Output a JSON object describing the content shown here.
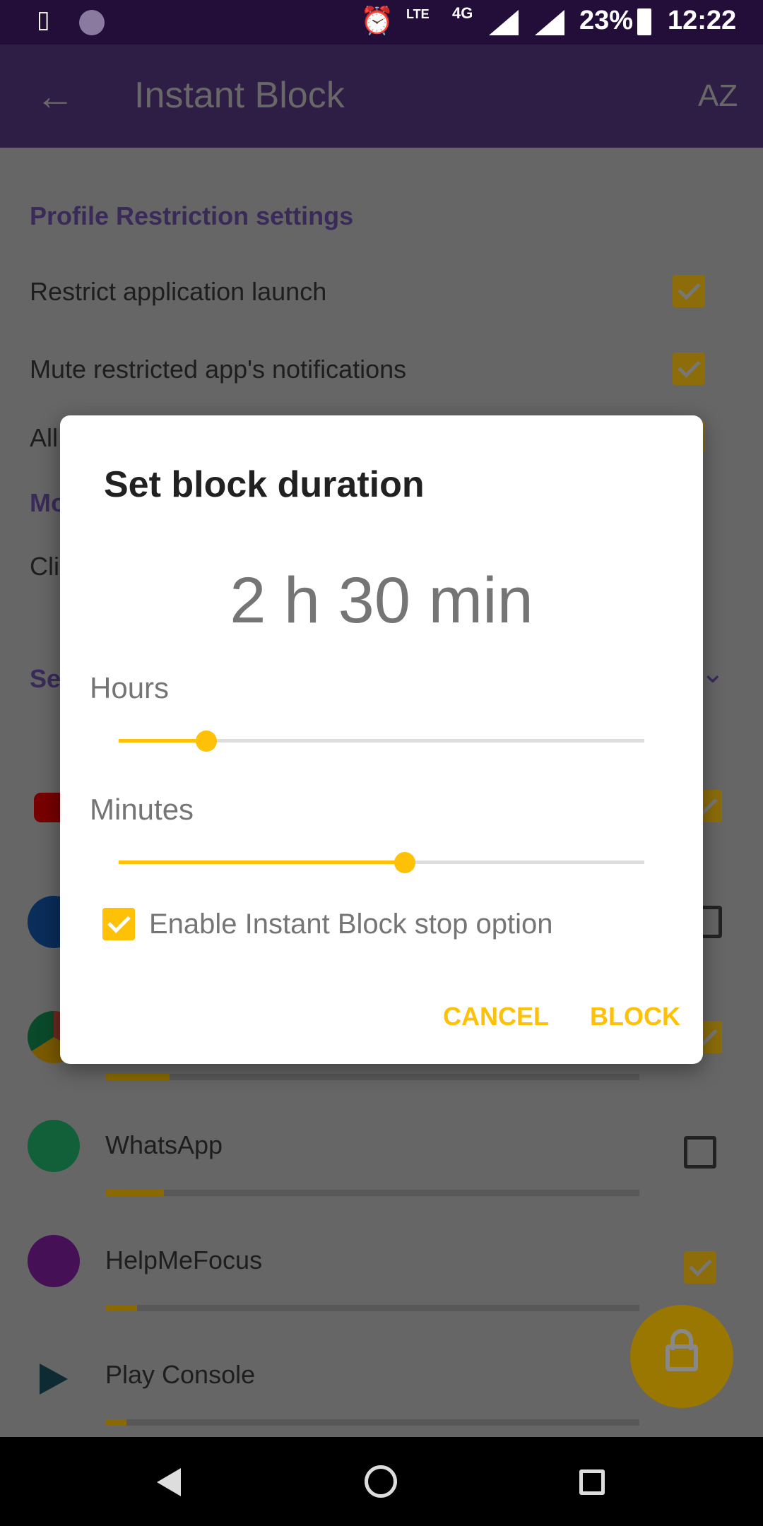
{
  "status_bar": {
    "battery": "23%",
    "time": "12:22",
    "network": "4G",
    "lte": "LTE"
  },
  "toolbar": {
    "title": "Instant Block",
    "back_icon": "arrow-left-icon",
    "sort_icon": "sort-az-icon"
  },
  "settings": {
    "section_title": "Profile Restriction settings",
    "rows": [
      {
        "label": "Restrict application launch",
        "checked": true
      },
      {
        "label": "Mute restricted app's notifications",
        "checked": true
      },
      {
        "label": "All",
        "checked": true
      }
    ],
    "section2_partial": "Mo",
    "row_partial": "Cli",
    "section3_partial": "Se"
  },
  "apps": [
    {
      "name": "",
      "icon": "youtube-icon",
      "checked": true,
      "usage": 0
    },
    {
      "name": "",
      "icon": "phone-icon",
      "checked": false,
      "usage": 0
    },
    {
      "name": "",
      "icon": "chrome-icon",
      "checked": true,
      "usage": 0.12
    },
    {
      "name": "WhatsApp",
      "icon": "whatsapp-icon",
      "checked": false,
      "usage": 0.11
    },
    {
      "name": "HelpMeFocus",
      "icon": "helpmefocus-icon",
      "checked": true,
      "usage": 0.06
    },
    {
      "name": "Play Console",
      "icon": "play-console-icon",
      "checked": true,
      "usage": 0.04
    }
  ],
  "dialog": {
    "title": "Set block duration",
    "duration": "2 h 30 min",
    "hours_label": "Hours",
    "hours_fraction": 0.167,
    "minutes_label": "Minutes",
    "minutes_fraction": 0.545,
    "stop_option_label": "Enable Instant Block stop option",
    "stop_option_checked": true,
    "cancel": "CANCEL",
    "block": "BLOCK"
  },
  "colors": {
    "accent": "#ffc107",
    "primary": "#74489f",
    "status_bar": "#230e3a"
  }
}
